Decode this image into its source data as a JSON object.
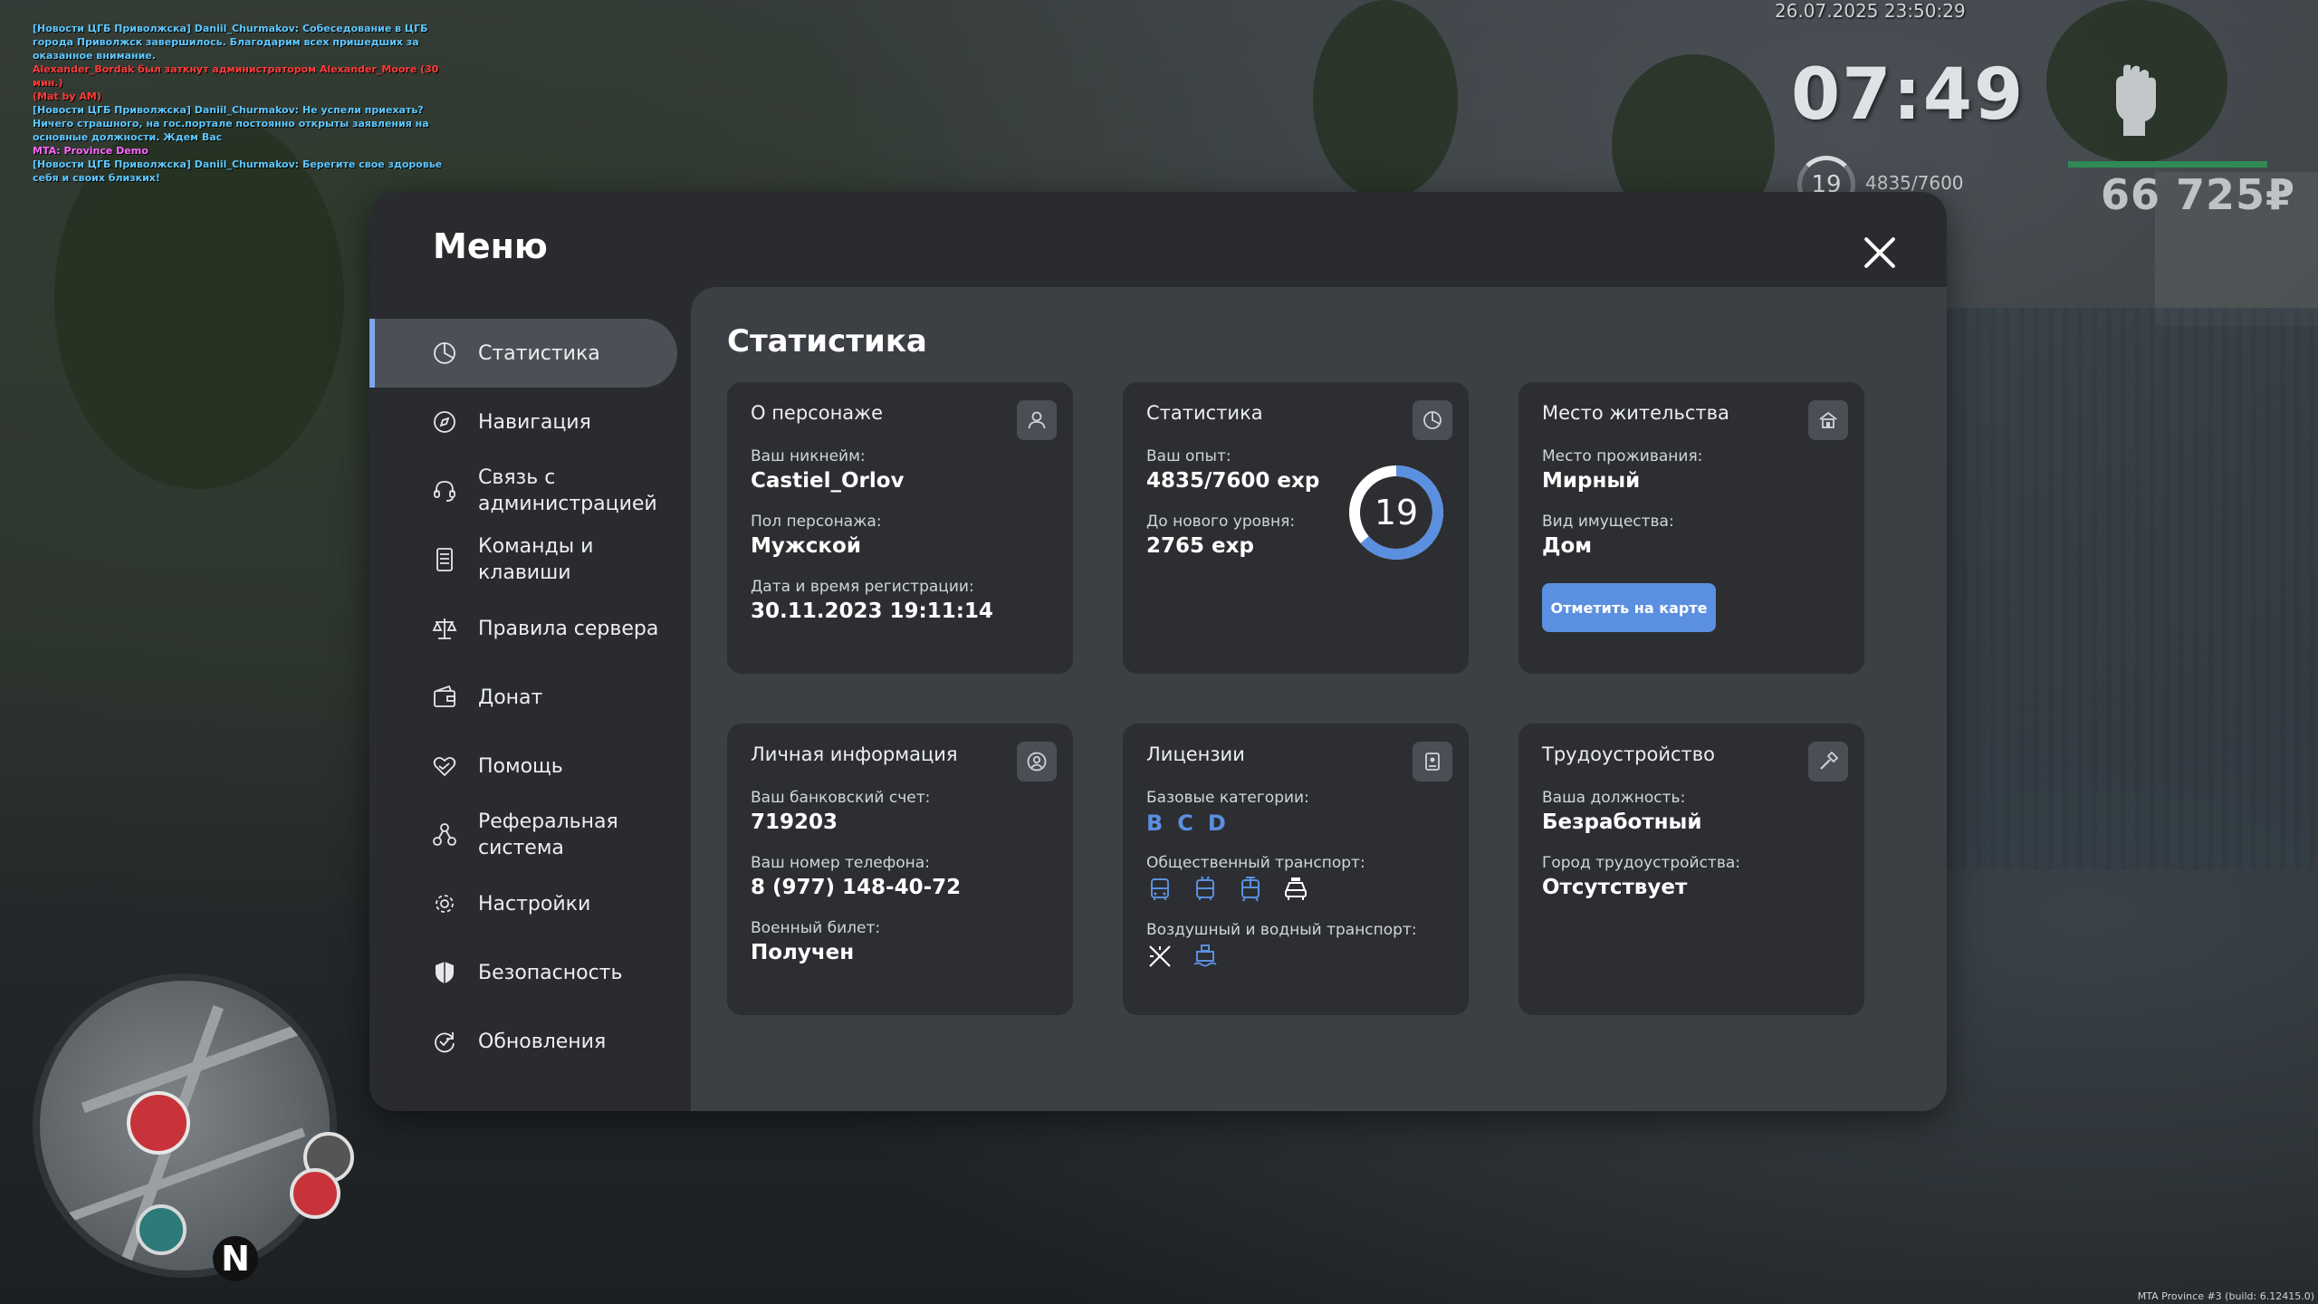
{
  "chat": [
    {
      "text": "[Новости ЦГБ Приволжска] Daniil_Churmakov: Собеседование в ЦГБ города Приволжск завершилось. Благодарим всех пришедших за оказанное внимание.",
      "color": "#5ec8ff"
    },
    {
      "text": "Alexander_Bordak был заткнут администратором Alexander_Moore (30 мин.)",
      "color": "#ff3b3b"
    },
    {
      "text": "(Mat by AM)",
      "color": "#ff3b3b"
    },
    {
      "text": "[Новости ЦГБ Приволжска] Daniil_Churmakov: Не успели приехать? Ничего страшного, на гос.портале постоянно открыты заявления на основные должности. Ждем Вас",
      "color": "#5ec8ff"
    },
    {
      "text": "MTA: Province Demo",
      "color": "#ff66ff"
    },
    {
      "text": "[Новости ЦГБ Приволжска] Daniil_Churmakov: Берегите свое здоровье себя и своих близких!",
      "color": "#5ec8ff"
    }
  ],
  "hud": {
    "datetime": "26.07.2025 23:50:29",
    "clock": "07:49",
    "level": "19",
    "exp": "4835/7600",
    "money": "66 725₽",
    "health_fraction": 1.0
  },
  "minimap": {
    "north": "N"
  },
  "build": "MTA Province #3 (build: 6.12415.0)",
  "menu": {
    "title": "Меню",
    "sidebar": [
      {
        "id": "stats",
        "label": "Статистика",
        "icon": "pie-chart-icon",
        "active": true
      },
      {
        "id": "nav",
        "label": "Навигация",
        "icon": "compass-icon",
        "active": false
      },
      {
        "id": "admin",
        "label": "Связь с администрацией",
        "icon": "headset-icon",
        "active": false
      },
      {
        "id": "commands",
        "label": "Команды и клавиши",
        "icon": "document-icon",
        "active": false
      },
      {
        "id": "rules",
        "label": "Правила сервера",
        "icon": "scales-icon",
        "active": false
      },
      {
        "id": "donate",
        "label": "Донат",
        "icon": "wallet-icon",
        "active": false
      },
      {
        "id": "help",
        "label": "Помощь",
        "icon": "heart-hand-icon",
        "active": false
      },
      {
        "id": "referral",
        "label": "Реферальная система",
        "icon": "network-icon",
        "active": false
      },
      {
        "id": "settings",
        "label": "Настройки",
        "icon": "gear-icon",
        "active": false
      },
      {
        "id": "security",
        "label": "Безопасность",
        "icon": "shield-icon",
        "active": false
      },
      {
        "id": "updates",
        "label": "Обновления",
        "icon": "refresh-check-icon",
        "active": false
      }
    ],
    "content_title": "Статистика",
    "cards": {
      "character": {
        "title": "О персонаже",
        "icon": "user-icon",
        "nickname_label": "Ваш никнейм:",
        "nickname": "Castiel_Orlov",
        "gender_label": "Пол персонажа:",
        "gender": "Мужской",
        "reg_label": "Дата и время регистрации:",
        "reg": "30.11.2023 19:11:14"
      },
      "stats": {
        "title": "Статистика",
        "icon": "pie-chart-icon",
        "exp_label": "Ваш опыт:",
        "exp": "4835/7600 exp",
        "next_label": "До нового уровня:",
        "next": "2765 exp",
        "level": "19",
        "progress": 0.636,
        "ring_color": "#5b8fe0"
      },
      "residence": {
        "title": "Место жительства",
        "icon": "house-icon",
        "place_label": "Место проживания:",
        "place": "Мирный",
        "property_label": "Вид имущества:",
        "property": "Дом",
        "button": "Отметить на карте"
      },
      "personal": {
        "title": "Личная информация",
        "icon": "person-circle-icon",
        "bank_label": "Ваш банковский счет:",
        "bank": "719203",
        "phone_label": "Ваш номер телефона:",
        "phone": "8 (977) 148-40-72",
        "military_label": "Военный билет:",
        "military": "Получен"
      },
      "licenses": {
        "title": "Лицензии",
        "icon": "id-card-icon",
        "base_label": "Базовые категории:",
        "categories": [
          "B",
          "C",
          "D"
        ],
        "public_label": "Общественный транспорт:",
        "public_icons": [
          "bus-icon",
          "trolleybus-icon",
          "tram-icon",
          "taxi-icon"
        ],
        "air_label": "Воздушный и водный транспорт:",
        "air_icons": [
          "plane-icon",
          "boat-icon"
        ]
      },
      "employment": {
        "title": "Трудоустройство",
        "icon": "hammer-icon",
        "position_label": "Ваша должность:",
        "position": "Безработный",
        "city_label": "Город трудоустройства:",
        "city": "Отсутствует"
      }
    }
  }
}
